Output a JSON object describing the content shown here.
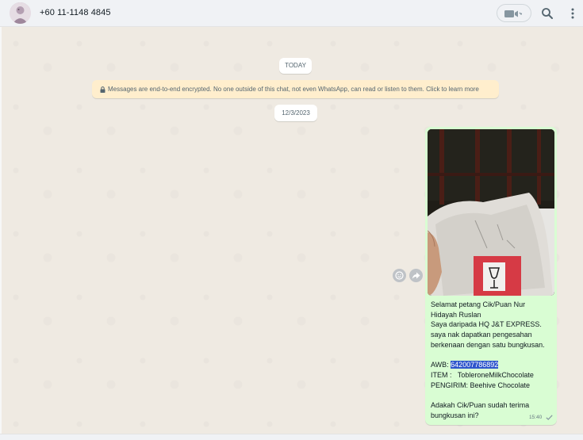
{
  "header": {
    "contact": "+60 11-1148 4845",
    "icons": [
      "avatar",
      "video-call-icon",
      "search-icon",
      "menu-icon"
    ]
  },
  "chat": {
    "today_label": "TODAY",
    "encryption_notice": "Messages are end-to-end encrypted. No one outside of this chat, not even WhatsApp, can read or listen to them. Click to learn more",
    "date_label": "12/3/2023",
    "message": {
      "line1": "Selamat petang Cik/Puan Nur",
      "line2": "Hidayah Ruslan",
      "line3": "Saya daripada HQ J&T EXPRESS.",
      "line4": "saya nak dapatkan pengesahan",
      "line5": "berkenaan dengan satu bungkusan.",
      "awb_label": "AWB: ",
      "awb_number": "642007786892",
      "item_line": "ITEM :   TobleroneMilkChocolate",
      "sender_line": "PENGIRIM: Beehive Chocolate",
      "question1": "Adakah Cik/Puan sudah terima",
      "question2": "bungkusan ini?",
      "time": "15:40",
      "status": "sent"
    },
    "photo_label": "FRAGILE"
  },
  "colors": {
    "chat_bg": "#efeae2",
    "outgoing_bubble": "#d9fdd3",
    "header_bg": "#f0f2f5",
    "notice_bg": "#ffeecd",
    "highlight": "#2e55cc"
  }
}
